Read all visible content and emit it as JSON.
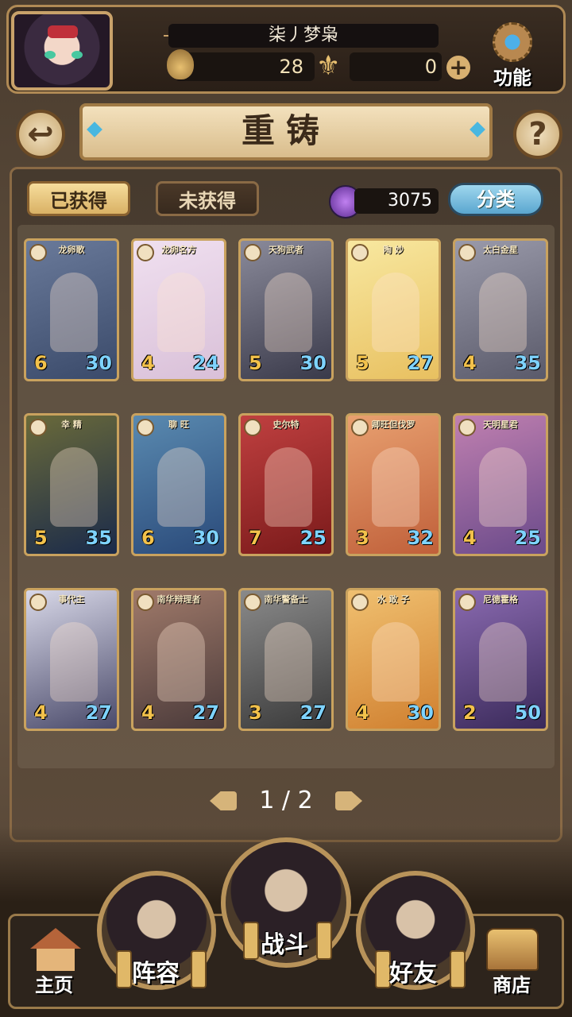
{
  "player": {
    "name": "柒丿梦枭",
    "stamina": "28",
    "gold": "0"
  },
  "header": {
    "func_label": "功能",
    "title": "重铸",
    "help": "?",
    "back": "↩"
  },
  "tabs": [
    {
      "label": "已获得"
    },
    {
      "label": "未获得"
    }
  ],
  "currency": {
    "value": "3075"
  },
  "sort_label": "分类",
  "cards": [
    {
      "name": "龙卵歌",
      "level": "6",
      "power": "30",
      "colors": [
        "#3a4a6a",
        "#6a7a9a"
      ]
    },
    {
      "name": "龙卵名方",
      "level": "4",
      "power": "24",
      "colors": [
        "#d9c0d8",
        "#f0e0f0"
      ]
    },
    {
      "name": "天狗武者",
      "level": "5",
      "power": "30",
      "colors": [
        "#3a3a4a",
        "#8a8a9a"
      ]
    },
    {
      "name": "陶 妙",
      "level": "5",
      "power": "27",
      "colors": [
        "#e8c060",
        "#f8e8a0"
      ]
    },
    {
      "name": "太白金星",
      "level": "4",
      "power": "35",
      "colors": [
        "#5a5a6a",
        "#9a9aaa"
      ]
    },
    {
      "name": "幸 精",
      "level": "5",
      "power": "35",
      "colors": [
        "#1a2a4a",
        "#6a6a3a"
      ]
    },
    {
      "name": "聊 旺",
      "level": "6",
      "power": "30",
      "colors": [
        "#2a4a7a",
        "#5a8ab0"
      ]
    },
    {
      "name": "史尔特",
      "level": "7",
      "power": "25",
      "colors": [
        "#7a1a1a",
        "#c04040"
      ]
    },
    {
      "name": "卿旺但伐罗",
      "level": "3",
      "power": "32",
      "colors": [
        "#c0603a",
        "#e8a070"
      ]
    },
    {
      "name": "天明星君",
      "level": "4",
      "power": "25",
      "colors": [
        "#6a4a8a",
        "#c080b0"
      ]
    },
    {
      "name": "事代主",
      "level": "4",
      "power": "27",
      "colors": [
        "#4a4a6a",
        "#d8d8e8"
      ]
    },
    {
      "name": "南华辩理者",
      "level": "4",
      "power": "27",
      "colors": [
        "#4a3a3a",
        "#a07a6a"
      ]
    },
    {
      "name": "南华警备士",
      "level": "3",
      "power": "27",
      "colors": [
        "#3a3a3a",
        "#8a8a8a"
      ]
    },
    {
      "name": "水 敢 子",
      "level": "4",
      "power": "30",
      "colors": [
        "#d08030",
        "#f0c070"
      ]
    },
    {
      "name": "尼德霍格",
      "level": "2",
      "power": "50",
      "colors": [
        "#3a2a5a",
        "#8a6ab0"
      ]
    }
  ],
  "pager": {
    "text": "1 / 2"
  },
  "nav": {
    "home": "主页",
    "team": "阵容",
    "battle": "战斗",
    "friends": "好友",
    "shop": "商店"
  }
}
